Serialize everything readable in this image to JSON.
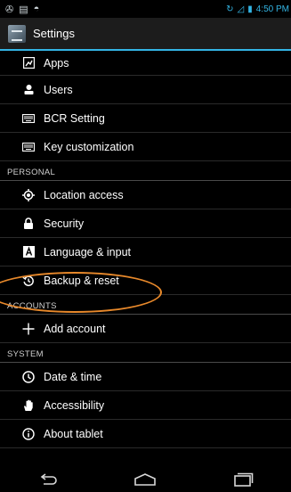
{
  "status_bar": {
    "time": "4:50 PM"
  },
  "action_bar": {
    "title": "Settings"
  },
  "rows": [
    {
      "label": "Apps",
      "icon": "apps-icon"
    },
    {
      "label": "Users",
      "icon": "users-icon"
    },
    {
      "label": "BCR Setting",
      "icon": "keyboard-icon"
    },
    {
      "label": "Key customization",
      "icon": "keyboard-icon"
    }
  ],
  "sections": {
    "personal": "PERSONAL",
    "accounts": "ACCOUNTS",
    "system": "SYSTEM"
  },
  "personal_rows": [
    {
      "label": "Location access",
      "icon": "location-icon"
    },
    {
      "label": "Security",
      "icon": "lock-icon"
    },
    {
      "label": "Language & input",
      "icon": "language-icon"
    },
    {
      "label": "Backup & reset",
      "icon": "backup-icon"
    }
  ],
  "accounts_rows": [
    {
      "label": "Add account",
      "icon": "plus-icon"
    }
  ],
  "system_rows": [
    {
      "label": "Date & time",
      "icon": "clock-icon"
    },
    {
      "label": "Accessibility",
      "icon": "hand-icon"
    },
    {
      "label": "About tablet",
      "icon": "info-icon"
    }
  ],
  "colors": {
    "accent": "#33b5e5",
    "highlight": "#e8892b"
  }
}
